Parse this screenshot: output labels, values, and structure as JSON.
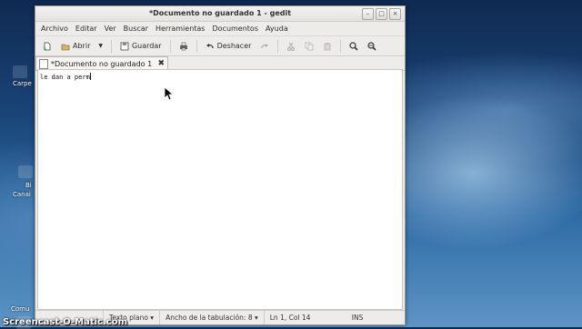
{
  "desktop": {
    "labels": [
      "Carpe",
      "Bi",
      "Canai",
      "Comu"
    ]
  },
  "window": {
    "title": "*Documento no guardado 1 - gedit",
    "controls": {
      "minimize": "–",
      "maximize": "□",
      "close": "×"
    }
  },
  "menu": [
    "Archivo",
    "Editar",
    "Ver",
    "Buscar",
    "Herramientas",
    "Documentos",
    "Ayuda"
  ],
  "toolbar": {
    "new": "",
    "open": "Abrir",
    "save": "Guardar",
    "print": "",
    "undo": "Deshacer"
  },
  "tab": {
    "label": "*Documento no guardado 1",
    "close": "✖"
  },
  "editor": {
    "text": "le dan a perm"
  },
  "status": {
    "mode": "Texto plano ▾",
    "tabwidth": "Ancho de la tabulación:  8 ▾",
    "position": "Ln 1, Col 14",
    "ins": "INS"
  },
  "watermark": "Screencast-O-Matic.com",
  "colors": {
    "accent": "#3e6ea8",
    "window_bg": "#edeceb"
  }
}
